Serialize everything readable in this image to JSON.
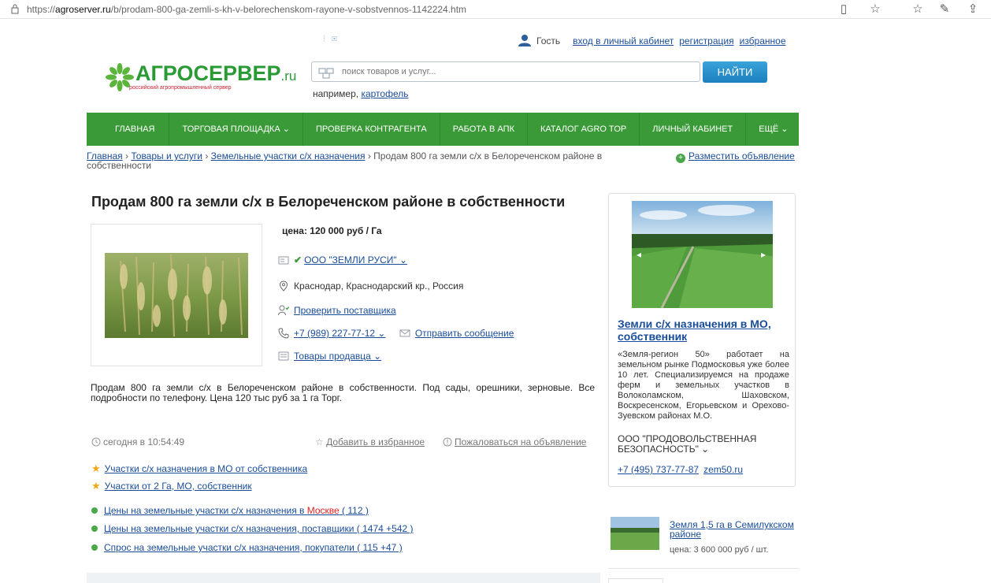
{
  "browser": {
    "url_prefix": "https://",
    "url_host": "agroserver.ru",
    "url_path": "/b/prodam-800-ga-zemli-s-kh-v-belorechenskom-rayone-v-sobstvennos-1142224.htm"
  },
  "user_bar": {
    "guest": "Гость",
    "login": "вход в личный кабинет",
    "register": "регистрация",
    "favorites": "избранное"
  },
  "logo": {
    "name": "АГРОСЕРВЕР",
    "tld": ".ru",
    "tagline": "российский агропромышленный сервер"
  },
  "search": {
    "placeholder": "поиск товаров и услуг...",
    "button": "НАЙТИ",
    "hint_prefix": "например, ",
    "hint_link": "картофель"
  },
  "nav": [
    "ГЛАВНАЯ",
    "ТОРГОВАЯ ПЛОЩАДКА ⌄",
    "ПРОВЕРКА КОНТРАГЕНТА",
    "РАБОТА В АПК",
    "КАТАЛОГ AGRO TOP",
    "ЛИЧНЫЙ КАБИНЕТ",
    "ЕЩЁ ⌄"
  ],
  "breadcrumb": {
    "home": "Главная",
    "goods": "Товары и услуги",
    "category": "Земельные участки с/х назначения",
    "current": "Продам 800 га земли с/х в Белореченском районе в собственности",
    "sep": "›"
  },
  "post_ad": "Разместить объявление",
  "listing": {
    "title": "Продам 800 га земли с/х в Белореченском районе в собственности",
    "price": "цена: 120 000 руб / Га",
    "seller": "ООО \"ЗЕМЛИ РУСИ\" ⌄",
    "location": "Краснодар, Краснодарский кр., Россия",
    "check_supplier": "Проверить поставщика",
    "phone": "+7 (989) 227-77-12 ⌄",
    "send_message": "Отправить сообщение",
    "seller_goods": "Товары продавца ⌄",
    "description": "Продам 800 га земли с/х в Белореченском районе в собственности. Под сады, орешники, зерновые. Все подробности по телефону. Цена 120 тыс руб за 1 га Торг.",
    "date": "сегодня в 10:54:49",
    "add_favorite": "Добавить в избранное",
    "complain": "Пожаловаться на объявление"
  },
  "related": {
    "starred": [
      "Участки с/х назначения в МО от собственника",
      "Участки от 2 Га, МО, собственник"
    ],
    "prices_prefix": "Цены на земельные участки с/х назначения в ",
    "prices_city": "Москве",
    "prices_count": " ( 112 )",
    "suppliers": "Цены на земельные участки с/х назначения, поставщики ( 1474 +542 )",
    "demand": "Спрос на земельные участки с/х назначения, покупатели ( 115 +47 )"
  },
  "ad": {
    "title": "Земли с/х назначения в МО, собственник",
    "text": "«Земля-регион 50» работает на земельном рынке Подмосковья уже более 10 лет. Специализируемся на продаже ферм и земельных участков в Волоколамском, Шаховском, Воскресенском, Егорьевском и Орехово-Зуевском районах М.О.",
    "company": "ООО \"ПРОДОВОЛЬСТВЕННАЯ БЕЗОПАСНОСТЬ\" ⌄",
    "phone": "+7 (495) 737-77-87",
    "site": "zem50.ru"
  },
  "side_item": {
    "title": "Земля 1,5 га в Семилукском районе",
    "price": "цена: 3 600 000 руб / шт."
  },
  "colors": {
    "nav_green": "#3a9a37",
    "link_blue": "#1a4d99",
    "search_button": "#1b7fbf",
    "logo_green": "#2a9a35"
  }
}
